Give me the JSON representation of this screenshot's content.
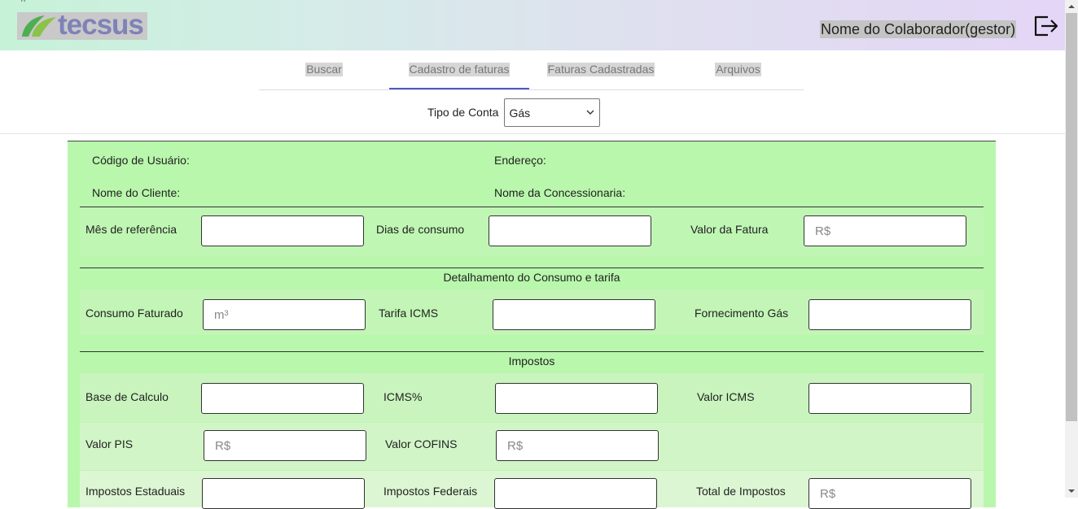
{
  "header": {
    "logo_text": "tecsus",
    "user_name": "Nome do Colaborador(gestor)"
  },
  "tabs": [
    {
      "label": "Buscar"
    },
    {
      "label": "Cadastro de faturas"
    },
    {
      "label": "Faturas Cadastradas"
    },
    {
      "label": "Arquivos"
    }
  ],
  "active_tab": "Cadastro de faturas",
  "tipo_conta": {
    "label": "Tipo de Conta",
    "value": "Gás"
  },
  "info": {
    "codigo_usuario": "Código de Usuário:",
    "endereco": "Endereço:",
    "nome_cliente": "Nome do Cliente:",
    "nome_concessionaria": "Nome da Concessionaria:"
  },
  "fields_row1": {
    "mes_ref": "Mês de referência",
    "dias_consumo": "Dias de consumo",
    "valor_fatura": "Valor da Fatura",
    "valor_fatura_ph": "R$"
  },
  "section_consumo": "Detalhamento do Consumo e tarifa",
  "fields_consumo": {
    "consumo_faturado": "Consumo Faturado",
    "consumo_faturado_ph": "m³",
    "tarifa_icms": "Tarifa ICMS",
    "fornecimento_gas": "Fornecimento Gás"
  },
  "section_impostos": "Impostos",
  "fields_impostos": {
    "base_calculo": "Base de Calculo",
    "icms_pct": "ICMS%",
    "valor_icms": "Valor ICMS",
    "valor_pis": "Valor PIS",
    "valor_pis_ph": "R$",
    "valor_cofins": "Valor COFINS",
    "valor_cofins_ph": "R$",
    "impostos_estaduais": "Impostos Estaduais",
    "impostos_federais": "Impostos Federais",
    "total_impostos": "Total de Impostos",
    "total_impostos_ph": "R$"
  },
  "colors": {
    "form_bg": "#b9f7ac",
    "tab_active_underline": "#4a5bc4",
    "logo_text": "#7e82b8"
  }
}
